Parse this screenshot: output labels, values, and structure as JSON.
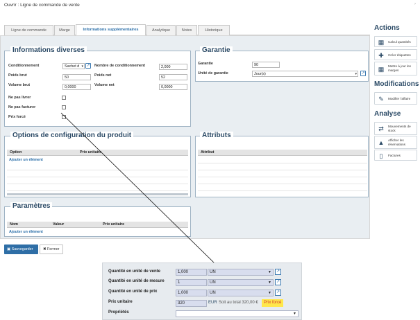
{
  "window": {
    "title": "Ouvrir : Ligne de commande de vente",
    "close": "›"
  },
  "tabs": [
    "Ligne de commande",
    "Marge",
    "Informations supplémentaires",
    "Analytique",
    "Notes",
    "Historique"
  ],
  "info": {
    "legend": "Informations diverses",
    "conditionnement_label": "Conditionnement",
    "conditionnement_value": "Sachet d",
    "nb_cond_label": "Nombre de conditionnement",
    "nb_cond_value": "2,000",
    "poids_brut_label": "Poids brut",
    "poids_brut_value": "50",
    "poids_net_label": "Poids net",
    "poids_net_value": "52",
    "vol_brut_label": "Volume brut",
    "vol_brut_value": "0,0000",
    "vol_net_label": "Volume net",
    "vol_net_value": "0,0000",
    "ne_pas_livrer": "Ne pas livrer",
    "ne_pas_facturer": "Ne pas facturer",
    "prix_force": "Prix forcé"
  },
  "garantie": {
    "legend": "Garantie",
    "garantie_label": "Garantie",
    "garantie_value": "90",
    "unite_label": "Unité de garantie",
    "unite_value": "Jour(s)"
  },
  "options": {
    "legend": "Options de configuration du produit",
    "col_option": "Option",
    "col_prix": "Prix unitaire",
    "add": "Ajouter un élément"
  },
  "attributs": {
    "legend": "Attributs",
    "col_attribut": "Attribut"
  },
  "parametres": {
    "legend": "Paramètres",
    "col_nom": "Nom",
    "col_valeur": "Valeur",
    "col_prix": "Prix unitaire",
    "add": "Ajouter un élément"
  },
  "sidebar": {
    "actions_title": "Actions",
    "actions": [
      "Calcul quantités",
      "Créer étiquettes",
      "Mettre à jour les marges"
    ],
    "modif_title": "Modifications",
    "modifs": [
      "Modifier l'affaire"
    ],
    "analyse_title": "Analyse",
    "analyses": [
      "Mouvements de stock",
      "Afficher les réservations",
      "Factures"
    ]
  },
  "footer": {
    "save": "Sauvegarder",
    "close": "Fermer"
  },
  "zoom": {
    "qte_vente_label": "Quantité en unité de vente",
    "qte_vente_value": "1,000",
    "qte_vente_unit": "UN",
    "qte_mesure_label": "Quantité en unité de mesure",
    "qte_mesure_value": "1",
    "qte_mesure_unit": "UN",
    "qte_prix_label": "Quantité en unité de prix",
    "qte_prix_value": "1,000",
    "qte_prix_unit": "UN",
    "prix_label": "Prix unitaire",
    "prix_value": "320",
    "prix_currency": "EUR",
    "prix_total": "Soit au total 320,00 €",
    "prix_force": "Prix forcé",
    "proprietes_label": "Propriétés"
  },
  "colors": {
    "accent": "#2e6ea6",
    "legend": "#2b4a66",
    "highlight": "#ffe74a",
    "highlight_text": "#d33a2c"
  }
}
